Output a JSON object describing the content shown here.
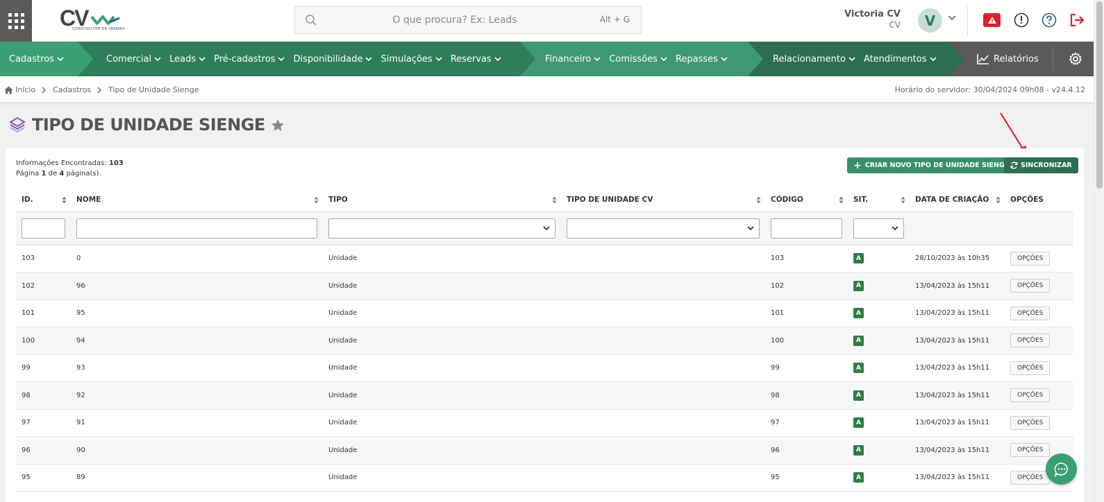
{
  "header": {
    "logo_text": "CV",
    "logo_sub": "CONSTRUTOR DE VENDAS",
    "search_placeholder": "O que procura? Ex: Leads",
    "search_shortcut": "Alt + G",
    "user_name": "Victoria CV",
    "user_sub": "CV",
    "avatar_letter": "V"
  },
  "nav": {
    "group1": [
      "Cadastros"
    ],
    "group2": [
      "Comercial",
      "Leads",
      "Pré-cadastros",
      "Disponibilidade",
      "Simulações",
      "Reservas"
    ],
    "group3": [
      "Financeiro",
      "Comissões",
      "Repasses"
    ],
    "group4": [
      "Relacionamento",
      "Atendimentos"
    ],
    "reports": "Relatórios"
  },
  "breadcrumb": {
    "home": "Início",
    "level1": "Cadastros",
    "level2": "Tipo de Unidade Sienge",
    "server_time": "Horário do servidor: 30/04/2024 09h08 - v24.4.12"
  },
  "page": {
    "title": "TIPO DE UNIDADE SIENGE"
  },
  "info": {
    "found_label": "Informações Encontradas: ",
    "found_count": "103",
    "page_prefix": "Página ",
    "page_current": "1",
    "page_mid": " de ",
    "page_total": "4",
    "page_suffix": " página(s)."
  },
  "buttons": {
    "create": "CRIAR NOVO TIPO DE UNIDADE SIENGE",
    "sync": "SINCRONIZAR"
  },
  "table": {
    "headers": {
      "id": "ID.",
      "nome": "NOME",
      "tipo": "TIPO",
      "tipo_cv": "TIPO DE UNIDADE CV",
      "codigo": "CÓDIGO",
      "sit": "SIT.",
      "data": "DATA DE CRIAÇÃO",
      "opcoes": "OPÇÕES"
    },
    "rows": [
      {
        "id": "103",
        "nome": "0",
        "tipo": "Unidade",
        "tipo_cv": "",
        "codigo": "103",
        "sit": "A",
        "data": "28/10/2023 às 10h35",
        "opt": "OPÇÕES"
      },
      {
        "id": "102",
        "nome": "96",
        "tipo": "Unidade",
        "tipo_cv": "",
        "codigo": "102",
        "sit": "A",
        "data": "13/04/2023 às 15h11",
        "opt": "OPÇÕES"
      },
      {
        "id": "101",
        "nome": "95",
        "tipo": "Unidade",
        "tipo_cv": "",
        "codigo": "101",
        "sit": "A",
        "data": "13/04/2023 às 15h11",
        "opt": "OPÇÕES"
      },
      {
        "id": "100",
        "nome": "94",
        "tipo": "Unidade",
        "tipo_cv": "",
        "codigo": "100",
        "sit": "A",
        "data": "13/04/2023 às 15h11",
        "opt": "OPÇÕES"
      },
      {
        "id": "99",
        "nome": "93",
        "tipo": "Unidade",
        "tipo_cv": "",
        "codigo": "99",
        "sit": "A",
        "data": "13/04/2023 às 15h11",
        "opt": "OPÇÕES"
      },
      {
        "id": "98",
        "nome": "92",
        "tipo": "Unidade",
        "tipo_cv": "",
        "codigo": "98",
        "sit": "A",
        "data": "13/04/2023 às 15h11",
        "opt": "OPÇÕES"
      },
      {
        "id": "97",
        "nome": "91",
        "tipo": "Unidade",
        "tipo_cv": "",
        "codigo": "97",
        "sit": "A",
        "data": "13/04/2023 às 15h11",
        "opt": "OPÇÕES"
      },
      {
        "id": "96",
        "nome": "90",
        "tipo": "Unidade",
        "tipo_cv": "",
        "codigo": "96",
        "sit": "A",
        "data": "13/04/2023 às 15h11",
        "opt": "OPÇÕES"
      },
      {
        "id": "95",
        "nome": "89",
        "tipo": "Unidade",
        "tipo_cv": "",
        "codigo": "95",
        "sit": "A",
        "data": "13/04/2023 às 15h11",
        "opt": "OPÇÕES"
      }
    ]
  },
  "colors": {
    "brand_green": "#2f7d5b",
    "light_green": "#3a9f75",
    "status_green": "#2f7d45",
    "alert_red": "#d9232d",
    "annotation_red": "#e8161b"
  },
  "icons": {
    "apps": "apps-grid-icon",
    "search": "search-icon",
    "alert": "alert-triangle-icon",
    "info": "info-icon",
    "help": "help-icon",
    "logout": "logout-icon",
    "reports": "chart-line-icon",
    "settings": "gear-icon",
    "home": "home-icon",
    "favorite": "star-icon",
    "sync": "refresh-icon",
    "chat": "chat-icon"
  }
}
